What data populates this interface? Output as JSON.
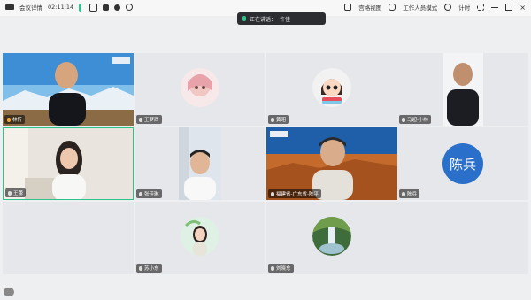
{
  "topbar": {
    "left": {
      "app_label": "会议详情",
      "timer": "02:11:14",
      "signal_icon": "signal-bars-icon",
      "share_icon": "share-icon",
      "screen_icon": "screen-icon",
      "record_icon": "record-icon",
      "settings_icon": "settings-icon"
    },
    "right": {
      "view_label": "宫格视图",
      "assistant_label": "工作人员模式",
      "timer_label": "计时",
      "expand_icon": "expand-icon"
    }
  },
  "speaker_bar": {
    "icon": "mic-icon",
    "label": "正在讲话：",
    "name": "许佳"
  },
  "tiles": [
    {
      "name": "林忻",
      "type": "video-man-mountain"
    },
    {
      "name": "王梦西",
      "type": "avatar-anime-girl"
    },
    {
      "name": "黄昭",
      "type": "avatar-cartoon-girl"
    },
    {
      "name": "马超-小林",
      "type": "video-man-white"
    },
    {
      "name": "王蕾",
      "type": "video-woman"
    },
    {
      "name": "张佳琳",
      "type": "video-man-door"
    },
    {
      "name": "福建省-广东省-陈平",
      "type": "video-man-desert"
    },
    {
      "name": "陈兵",
      "type": "avatar-text",
      "avatar_text": "陈兵",
      "color": "#2a6fc9"
    },
    {
      "name": "",
      "type": "blank"
    },
    {
      "name": "苏小东",
      "type": "avatar-woman-photo"
    },
    {
      "name": "刘晓东",
      "type": "avatar-waterfall"
    },
    {
      "name": "",
      "type": "blank"
    }
  ],
  "colors": {
    "accent_green": "#2cc38a",
    "avatar_blue": "#2a6fc9",
    "panel": "#e6e7ea"
  }
}
